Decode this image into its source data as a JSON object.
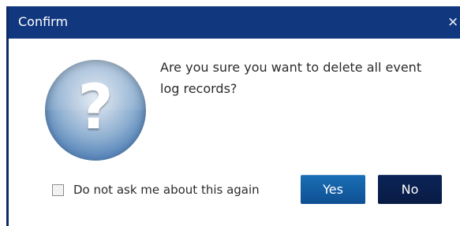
{
  "dialog": {
    "title": "Confirm",
    "close_glyph": "×",
    "message": "Are you sure you want to delete all event log records?",
    "checkbox": {
      "label": "Do not ask me about this again",
      "checked": false
    },
    "buttons": {
      "yes": "Yes",
      "no": "No"
    },
    "icons": {
      "question": "question-icon",
      "close": "close-icon"
    },
    "colors": {
      "titlebar": "#11377f",
      "yes_button": "#0f4f93",
      "no_button": "#081b43",
      "text": "#2b2b2b"
    }
  }
}
